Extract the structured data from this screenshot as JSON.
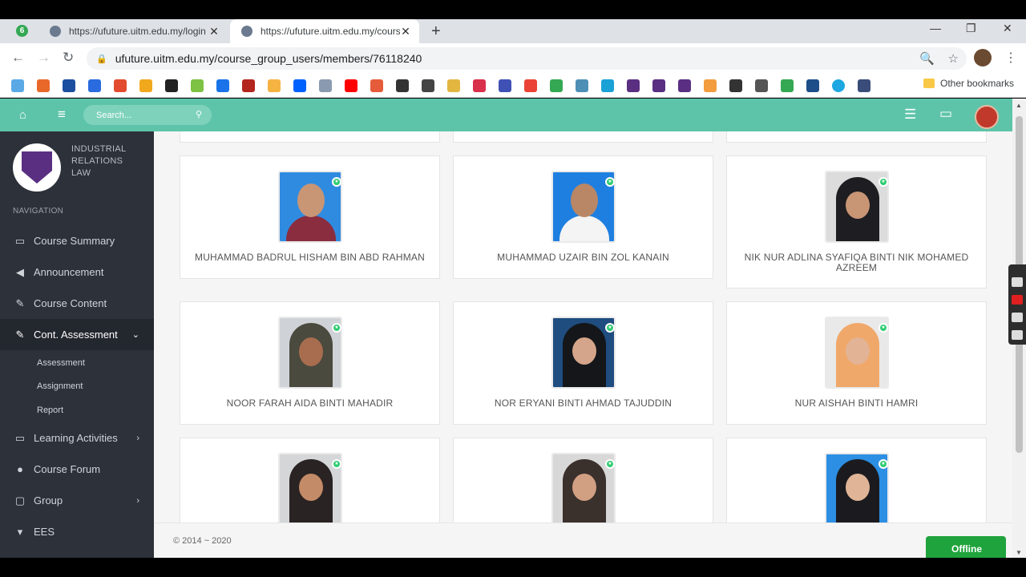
{
  "browser": {
    "tabs": [
      {
        "title": "https://ufuture.uitm.edu.my/login",
        "active": false
      },
      {
        "title": "https://ufuture.uitm.edu.my/course_group_users/members/76118240",
        "active": true
      }
    ],
    "tab_count_badge": "6",
    "url": "ufuture.uitm.edu.my/course_group_users/members/76118240",
    "other_bookmarks": "Other bookmarks"
  },
  "header": {
    "search_placeholder": "Search..."
  },
  "sidebar": {
    "course_name": "INDUSTRIAL RELATIONS LAW",
    "nav_label": "NAVIGATION",
    "items": [
      {
        "label": "Course Summary",
        "icon": "monitor-icon"
      },
      {
        "label": "Announcement",
        "icon": "megaphone-icon"
      },
      {
        "label": "Course Content",
        "icon": "pencil-icon"
      },
      {
        "label": "Cont. Assessment",
        "icon": "pencil-icon"
      },
      {
        "label": "Learning Activities",
        "icon": "monitor-icon"
      },
      {
        "label": "Course Forum",
        "icon": "chat-icon"
      },
      {
        "label": "Group",
        "icon": "lock-icon"
      },
      {
        "label": "EES",
        "icon": "pin-icon"
      }
    ],
    "sub_items": [
      "Assessment",
      "Assignment",
      "Report"
    ]
  },
  "members": [
    {
      "name": "MUHAMMAD BADRUL HISHAM BIN ABD RAHMAN"
    },
    {
      "name": "MUHAMMAD UZAIR BIN ZOL KANAIN"
    },
    {
      "name": "NIK NUR ADLINA SYAFIQA BINTI NIK MOHAMED AZREEM"
    },
    {
      "name": "NOOR FARAH AIDA BINTI MAHADIR"
    },
    {
      "name": "NOR ERYANI BINTI AHMAD TAJUDDIN"
    },
    {
      "name": "NUR AISHAH BINTI HAMRI"
    },
    {
      "name": ""
    },
    {
      "name": ""
    },
    {
      "name": ""
    }
  ],
  "footer": {
    "copyright": "© 2014 ~ 2020",
    "status": "Offline"
  },
  "colors": {
    "header": "#5ec4a9",
    "sidebar": "#2d3139",
    "online_badge": "#2ecc71",
    "offline_tab": "#1fa33c"
  }
}
